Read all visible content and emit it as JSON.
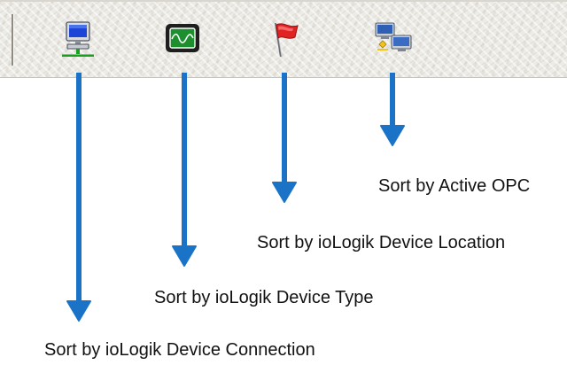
{
  "toolbar": {
    "buttons": [
      {
        "id": "connection",
        "icon": "network-computer-icon",
        "label": "Sort by ioLogik Device Connection"
      },
      {
        "id": "type",
        "icon": "monitor-waveform-icon",
        "label": "Sort by ioLogik Device Type"
      },
      {
        "id": "location",
        "icon": "red-flag-icon",
        "label": "Sort by ioLogik Device Location"
      },
      {
        "id": "opc",
        "icon": "active-opc-computers-icon",
        "label": "Sort by Active OPC"
      }
    ]
  },
  "colors": {
    "arrow": "#1a73c7",
    "flag": "#e02222",
    "monitor_screen": "#1d8f2e"
  }
}
